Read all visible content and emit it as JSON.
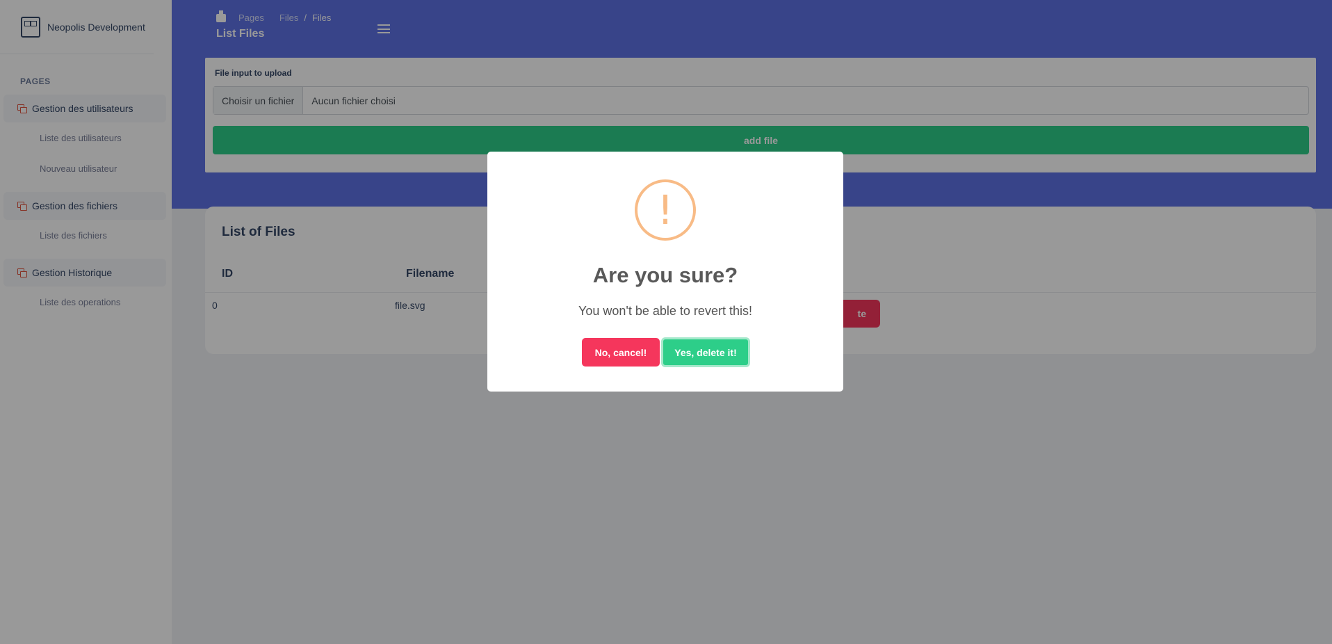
{
  "brand": {
    "name": "Neopolis Development"
  },
  "sidebar": {
    "section_title": "PAGES",
    "groups": [
      {
        "label": "Gestion des utilisateurs",
        "items": [
          "Liste des utilisateurs",
          "Nouveau utilisateur"
        ]
      },
      {
        "label": "Gestion des fichiers",
        "items": [
          "Liste des fichiers"
        ]
      },
      {
        "label": "Gestion Historique",
        "items": [
          "Liste des operations"
        ]
      }
    ]
  },
  "header": {
    "breadcrumb": [
      "Pages",
      "Files",
      "Files"
    ],
    "separator": "/",
    "title": "List Files"
  },
  "upload": {
    "label": "File input to upload",
    "choose_button": "Choisir un fichier",
    "no_file_text": "Aucun fichier choisi",
    "add_button": "add file"
  },
  "files": {
    "title": "List of Files",
    "columns": [
      "ID",
      "Filename"
    ],
    "rows": [
      {
        "id": "0",
        "filename": "file.svg",
        "action_partial": "te"
      }
    ]
  },
  "dialog": {
    "icon": "warning-icon",
    "mark": "!",
    "title": "Are you sure?",
    "text": "You won't be able to revert this!",
    "cancel_label": "No, cancel!",
    "confirm_label": "Yes, delete it!"
  },
  "colors": {
    "primary_band": "#5e72e4",
    "success": "#2dce89",
    "danger": "#f5365c",
    "warning_ring": "#f8bb86"
  }
}
